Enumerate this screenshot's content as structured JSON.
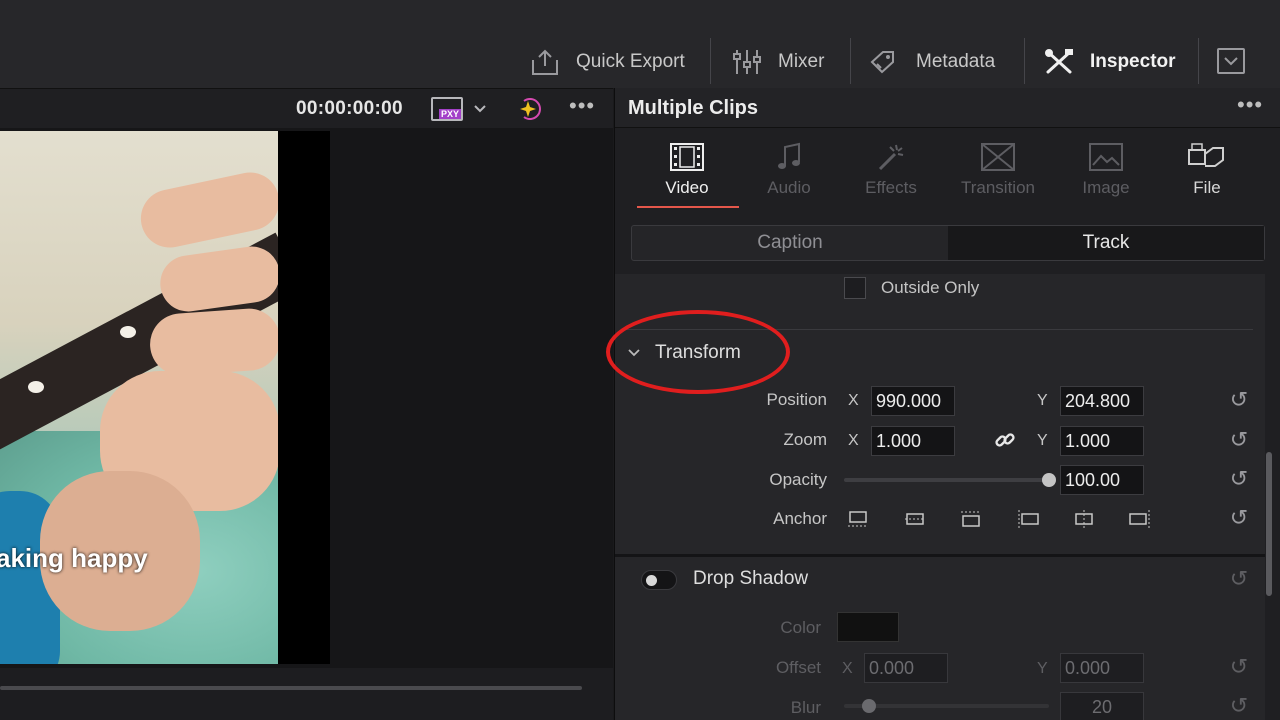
{
  "toolbar": {
    "quick_export": "Quick Export",
    "mixer": "Mixer",
    "metadata": "Metadata",
    "inspector": "Inspector"
  },
  "viewer": {
    "timecode": "00:00:00:00",
    "proxy_badge": "PXY",
    "caption": "aking happy"
  },
  "inspector": {
    "title": "Multiple Clips",
    "tabs": [
      {
        "label": "Video",
        "icon": "film-icon",
        "active": true
      },
      {
        "label": "Audio",
        "icon": "music-note-icon",
        "active": false
      },
      {
        "label": "Effects",
        "icon": "magic-wand-icon",
        "active": false
      },
      {
        "label": "Transition",
        "icon": "transition-icon",
        "active": false
      },
      {
        "label": "Image",
        "icon": "image-icon",
        "active": false
      },
      {
        "label": "File",
        "icon": "file-icon",
        "active": false
      }
    ],
    "subtabs": {
      "caption": "Caption",
      "track": "Track",
      "selected": "Track"
    },
    "outside_only": "Outside Only",
    "transform": {
      "title": "Transform",
      "position_label": "Position",
      "position_x": "990.000",
      "position_y": "204.800",
      "zoom_label": "Zoom",
      "zoom_x": "1.000",
      "zoom_y": "1.000",
      "opacity_label": "Opacity",
      "opacity": "100.00",
      "opacity_fraction": 1.0,
      "anchor_label": "Anchor",
      "x_axis": "X",
      "y_axis": "Y"
    },
    "drop_shadow": {
      "title": "Drop Shadow",
      "color_label": "Color",
      "color_value": "#111111",
      "offset_label": "Offset",
      "offset_x": "0.000",
      "offset_y": "0.000",
      "blur_label": "Blur",
      "blur": "20",
      "blur_fraction": 0.12,
      "x_axis": "X",
      "y_axis": "Y"
    }
  },
  "colors": {
    "accent": "#e4574b",
    "highlight": "#e01e1e"
  }
}
